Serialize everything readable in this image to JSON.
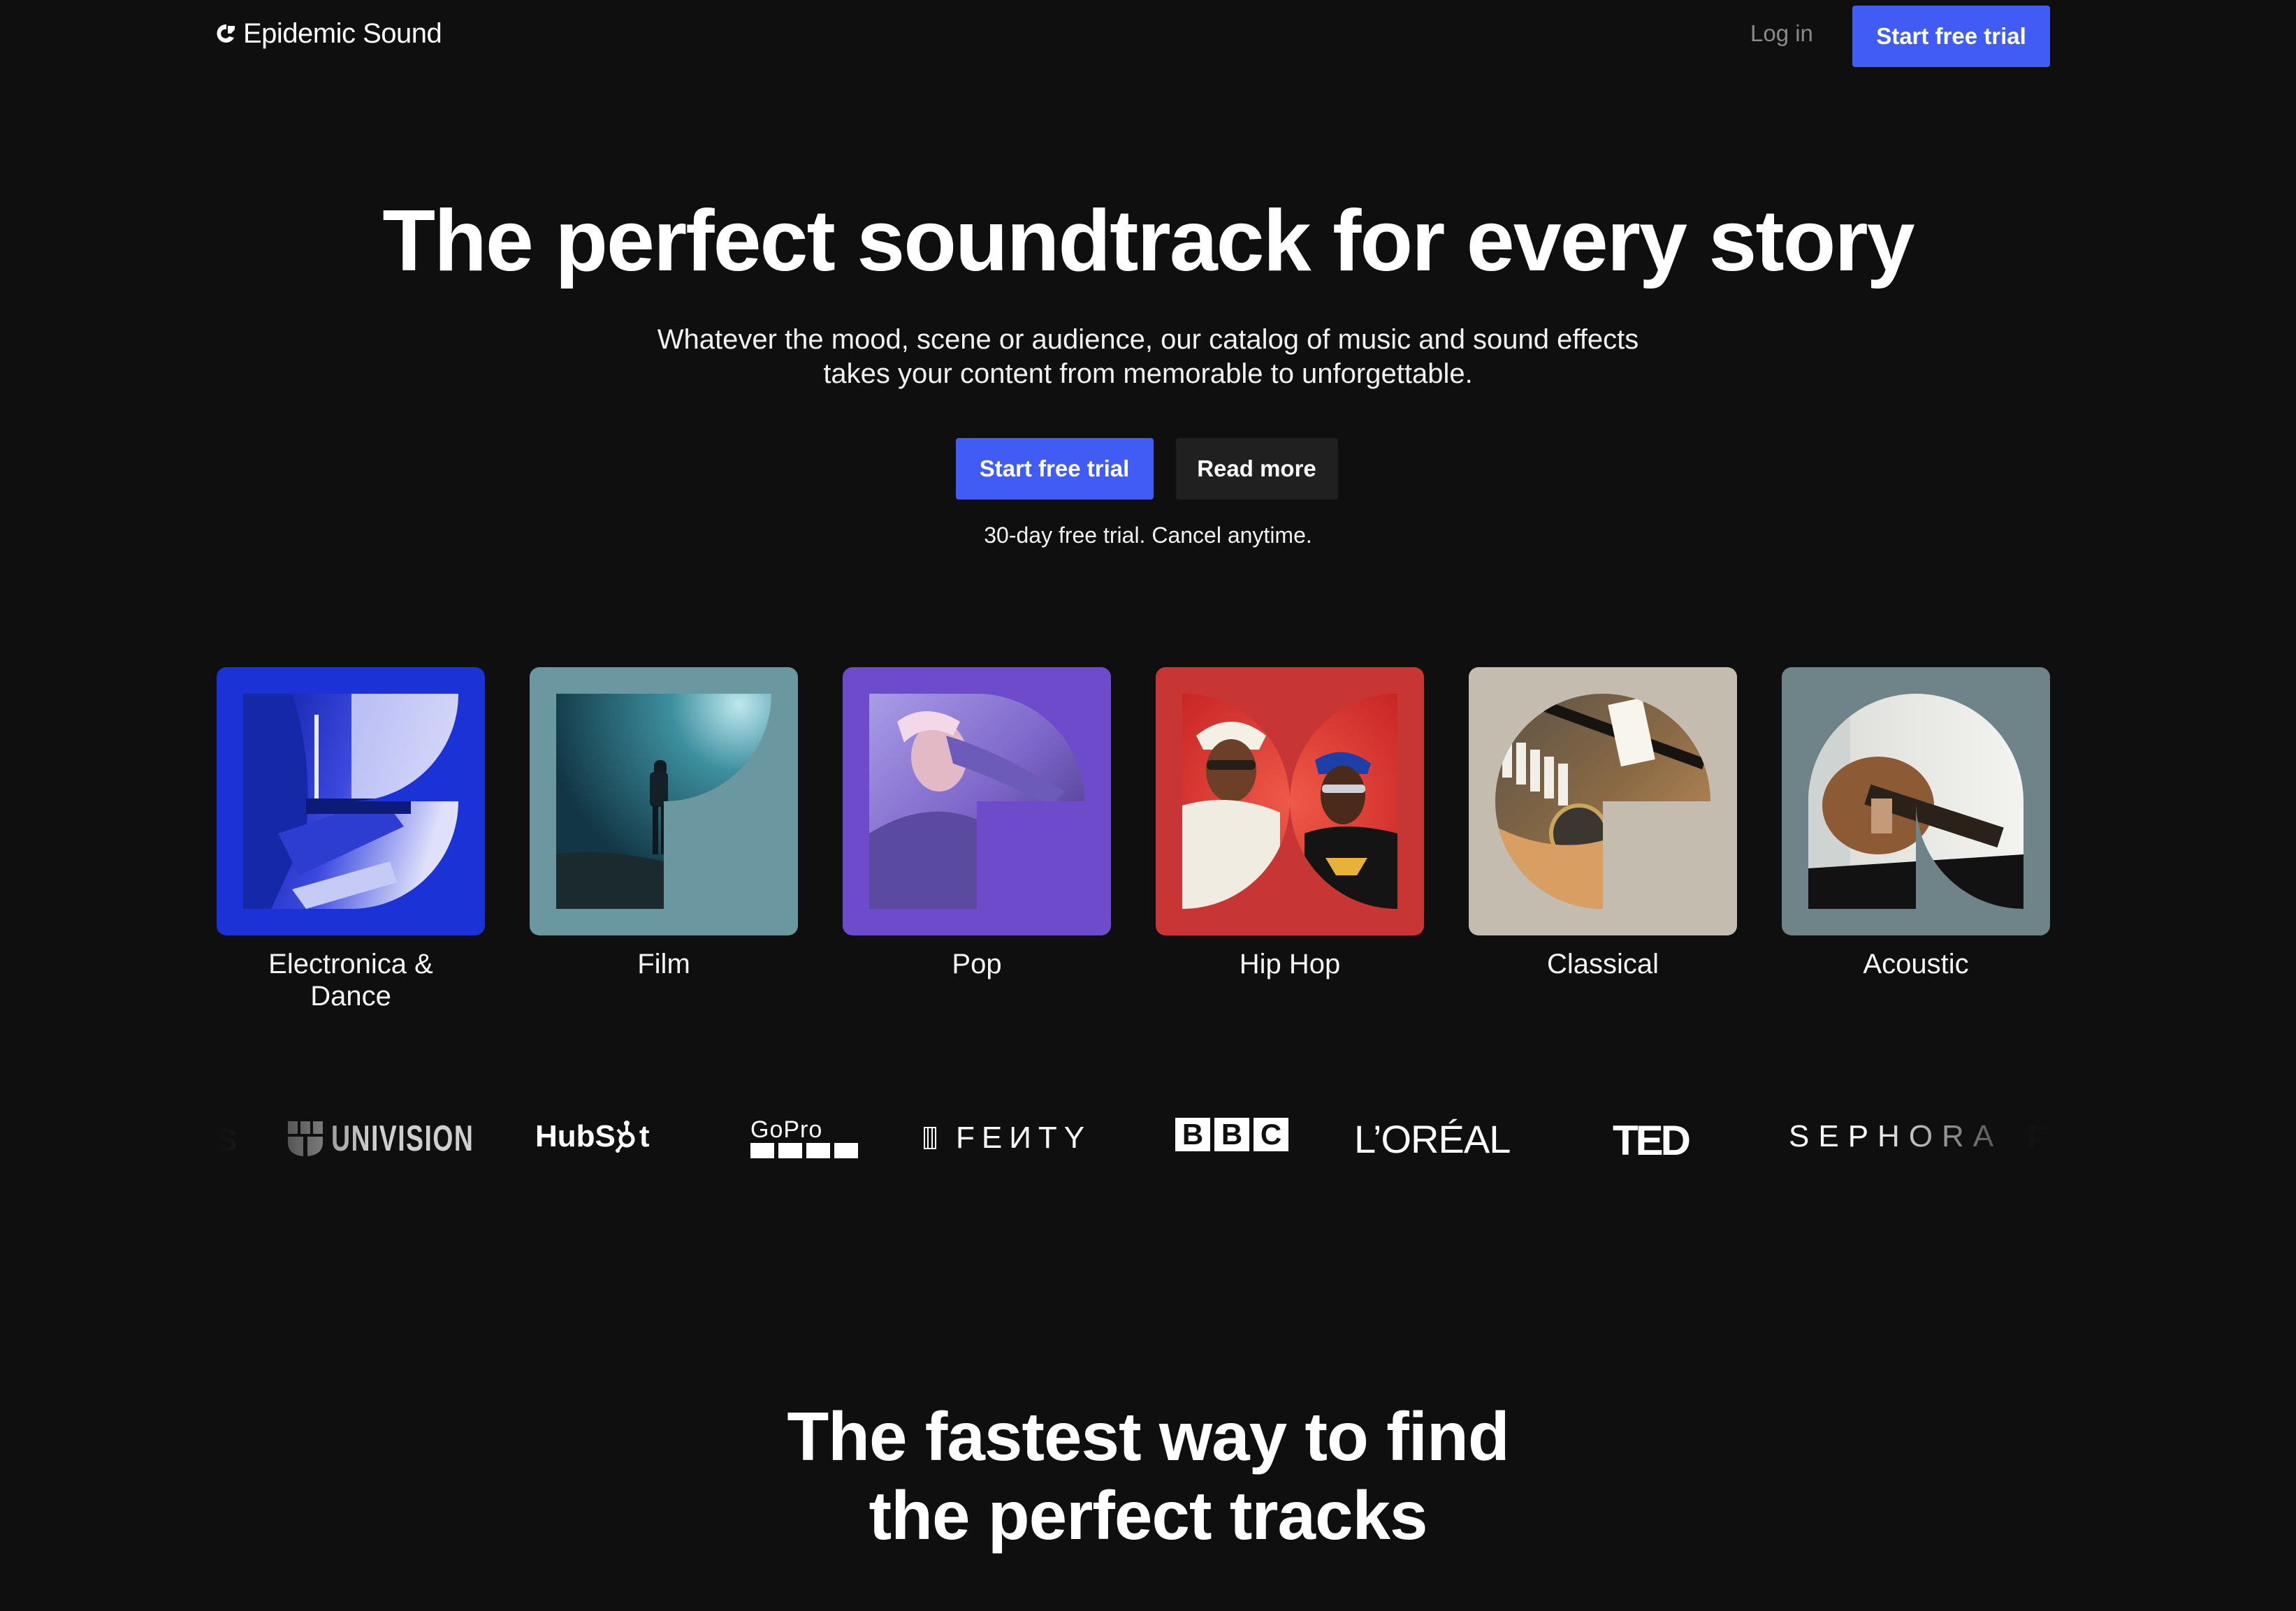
{
  "nav": {
    "brand": "Epidemic Sound",
    "brand_icon": "epidemic-logo-icon",
    "login_label": "Log in",
    "cta_label": "Start free trial"
  },
  "hero": {
    "title": "The perfect soundtrack for every story",
    "subtitle_line1": "Whatever the mood, scene or audience, our catalog of music and sound effects",
    "subtitle_line2": "takes your content from memorable to unforgettable.",
    "primary_label": "Start free trial",
    "secondary_label": "Read more",
    "note": "30-day free trial. Cancel anytime."
  },
  "genres": [
    {
      "label": "Electronica & Dance",
      "color": "#1a32d6",
      "image": "musician-playing-keyboard"
    },
    {
      "label": "Film",
      "color": "#6a97a0",
      "image": "hiker-on-rocks-at-night"
    },
    {
      "label": "Pop",
      "color": "#6e4bcb",
      "image": "singer-in-sequin-outfit"
    },
    {
      "label": "Hip Hop",
      "color": "#c83535",
      "image": "two-artists-in-sunglasses"
    },
    {
      "label": "Classical",
      "color": "#c4bdaf",
      "image": "piano-and-microphone"
    },
    {
      "label": "Acoustic",
      "color": "#6e8489",
      "image": "person-playing-acoustic-guitar"
    }
  ],
  "logos": [
    "Univision",
    "HubSpot",
    "GoPro",
    "Fenty",
    "BBC",
    "L'ORÉAL",
    "TED",
    "SEPHORA"
  ],
  "logo_text": {
    "univision": "UNIVISION",
    "hubspot_a": "HubS",
    "hubspot_b": "t",
    "gopro": "GoPro",
    "fenty": "FEИTY",
    "bbc": [
      "B",
      "B",
      "C"
    ],
    "loreal": "L’ORÉAL",
    "ted": "TED",
    "sephora": "SEPHORA"
  },
  "section2": {
    "title_line1": "The fastest way to find",
    "title_line2": "the perfect tracks"
  },
  "colors": {
    "background": "#0f0f0f",
    "accent": "#405cf5",
    "secondary_button": "#202020",
    "muted_text": "#8a8a8a"
  }
}
